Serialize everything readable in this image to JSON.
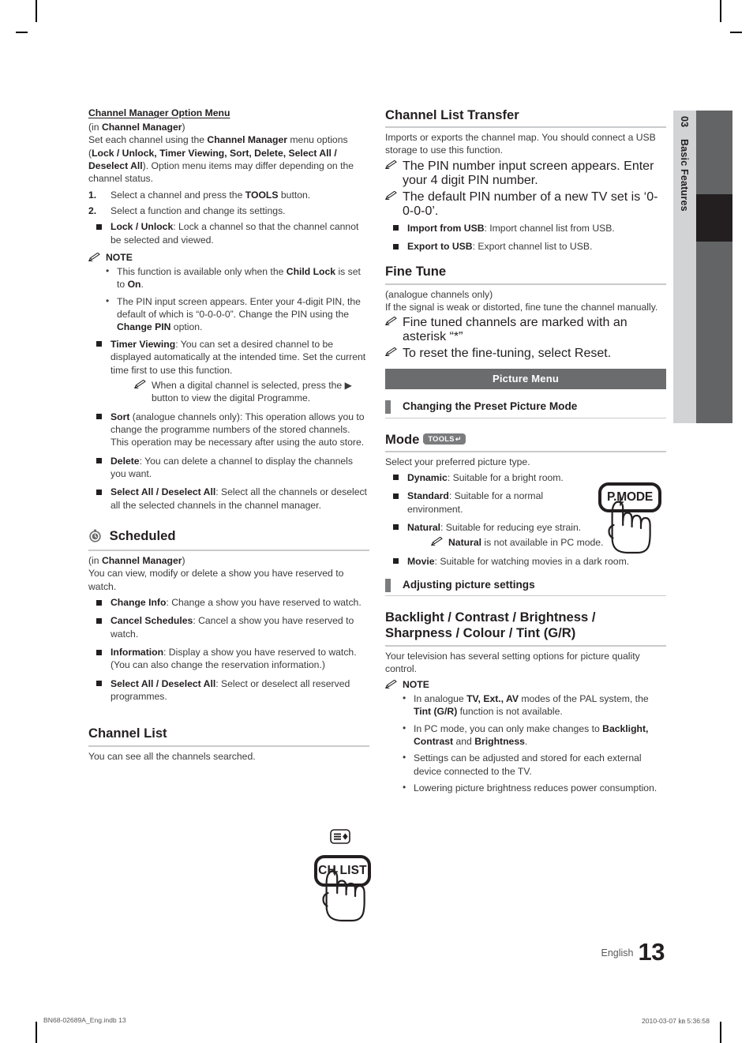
{
  "page": {
    "number": "13",
    "language": "English",
    "side_tab": {
      "chapter_number": "03",
      "chapter_title": "Basic Features"
    },
    "footer": {
      "file": "BN68-02689A_Eng.indb   13",
      "timestamp": "2010-03-07   ㎞ 5:36:58"
    }
  },
  "left_column": {
    "option_menu": {
      "subhead": "Channel Manager Option Menu",
      "in_line_prefix": "(in ",
      "in_line_bold": "Channel Manager",
      "in_line_suffix": ")",
      "intro_1": "Set each channel using the ",
      "intro_bold_1": "Channel Manager",
      "intro_2": " menu options (",
      "intro_bold_2": "Lock / Unlock, Timer Viewing, Sort, Delete, Select All / Deselect All",
      "intro_3": "). Option menu items may differ depending on the channel status.",
      "steps": [
        {
          "n": "1.",
          "text_1": "Select a channel and press the ",
          "bold": "TOOLS",
          "text_2": " button."
        },
        {
          "n": "2.",
          "text_1": "Select a function and change its settings.",
          "bold": "",
          "text_2": ""
        }
      ],
      "lock_unlock": {
        "term": "Lock / Unlock",
        "desc": ": Lock a channel so that the channel cannot be selected and viewed."
      },
      "note_label": "NOTE",
      "notes": [
        {
          "t1": "This function is available only when the ",
          "b1": "Child Lock",
          "t2": " is set to ",
          "b2": "On",
          "t3": "."
        },
        {
          "t1": "The PIN input screen appears. Enter your 4-digit PIN, the default of which is “0-0-0-0”. Change the PIN using the ",
          "b1": "Change PIN",
          "t2": " option.",
          "b2": "",
          "t3": ""
        }
      ],
      "timer_viewing": {
        "term": "Timer Viewing",
        "desc": ": You can set a desired channel to be displayed automatically at the intended time. Set the current time first to use this function."
      },
      "timer_note": "When a digital channel is selected, press the ▶ button to view the digital Programme.",
      "sort": {
        "term": "Sort",
        "desc": " (analogue channels only): This operation allows you to change the programme numbers of the stored channels. This operation may be necessary after using the auto store."
      },
      "delete": {
        "term": "Delete",
        "desc": ": You can delete a channel to display the channels you want."
      },
      "select_all": {
        "term": "Select All / Deselect All",
        "desc": ": Select all the channels or deselect all the selected channels in the channel manager."
      }
    },
    "scheduled": {
      "title": "Scheduled",
      "icon": "clock-icon",
      "in_line_prefix": "(in ",
      "in_line_bold": "Channel Manager",
      "in_line_suffix": ")",
      "intro": "You can view, modify or delete a show you have reserved to watch.",
      "items": [
        {
          "term": "Change Info",
          "desc": ": Change a show you have reserved to watch."
        },
        {
          "term": "Cancel Schedules",
          "desc": ": Cancel a show you have reserved to watch."
        },
        {
          "term": "Information",
          "desc": ": Display a show you have reserved to watch. (You can also change the reservation information.)"
        },
        {
          "term": "Select All / Deselect All",
          "desc": ": Select or deselect all reserved programmes."
        }
      ]
    },
    "channel_list": {
      "title": "Channel List",
      "body": "You can see all the channels searched.",
      "key_label": "CH LIST",
      "key_icon": "channel-list-icon"
    }
  },
  "right_column": {
    "channel_list_transfer": {
      "title": "Channel List Transfer",
      "intro": "Imports or exports the channel map. You should connect a USB storage to use this function.",
      "notes": [
        "The PIN number input screen appears. Enter your 4 digit PIN number.",
        "The default PIN number of a new TV set is ‘0-0-0-0’."
      ],
      "items": [
        {
          "term": "Import from USB",
          "desc": ": Import channel list from USB."
        },
        {
          "term": "Export to USB",
          "desc": ": Export channel list to USB."
        }
      ]
    },
    "fine_tune": {
      "title": "Fine Tune",
      "sub": "(analogue channels only)",
      "intro": "If the signal is weak or distorted, fine tune the channel manually.",
      "notes": [
        "Fine tuned channels are marked with an asterisk “*”",
        "To reset the fine-tuning, select Reset."
      ]
    },
    "picture_menu_bar": "Picture Menu",
    "preset_mode_head": "Changing the Preset Picture Mode",
    "mode": {
      "title": "Mode",
      "tools_badge": "TOOLS",
      "intro": "Select your preferred picture type.",
      "items": [
        {
          "term": "Dynamic",
          "desc": ": Suitable for a bright room."
        },
        {
          "term": "Standard",
          "desc": ": Suitable for a normal environment."
        },
        {
          "term": "Natural",
          "desc": ": Suitable for reducing eye strain."
        },
        {
          "term": "Movie",
          "desc": ": Suitable for watching movies in a dark room."
        }
      ],
      "natural_note_bold": "Natural",
      "natural_note_rest": " is not available in PC mode.",
      "key_label": "P.MODE"
    },
    "adjusting_head": "Adjusting picture settings",
    "backlight": {
      "title_line1": "Backlight / Contrast / Brightness /",
      "title_line2": "Sharpness / Colour / Tint (G/R)",
      "intro": "Your television has several setting options for picture quality control.",
      "note_label": "NOTE",
      "notes": [
        {
          "t1": "In analogue ",
          "b1": "TV, Ext., AV",
          "t2": " modes of the PAL system, the ",
          "b2": "Tint (G/R)",
          "t3": " function is not available."
        },
        {
          "t1": "In PC mode, you can only make changes to ",
          "b1": "Backlight, Contrast",
          "t2": " and ",
          "b2": "Brightness",
          "t3": "."
        },
        {
          "t1": "Settings can be adjusted and stored for each external device connected to the TV.",
          "b1": "",
          "t2": "",
          "b2": "",
          "t3": ""
        },
        {
          "t1": "Lowering picture brightness reduces power consumption.",
          "b1": "",
          "t2": "",
          "b2": "",
          "t3": ""
        }
      ]
    }
  },
  "colors": {
    "accent_grey": "#6b6c6e",
    "tab_light": "#d2d3d5",
    "tab_dark": "#636466",
    "tab_active": "#231f20",
    "rule": "#c9cacc"
  }
}
